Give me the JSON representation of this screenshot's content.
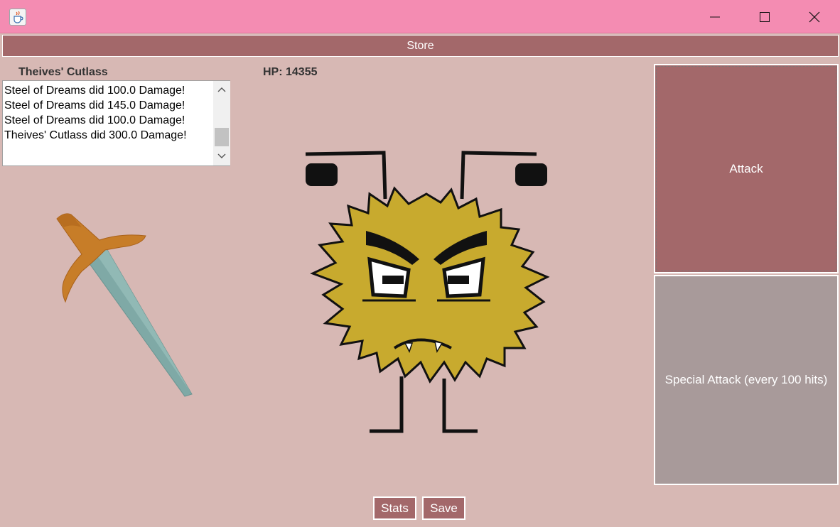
{
  "window": {
    "icon": "java-cup-icon",
    "controls": [
      "minimize-icon",
      "maximize-icon",
      "close-icon"
    ]
  },
  "store": {
    "label": "Store"
  },
  "weapon": {
    "name": "Theives' Cutlass",
    "image": "sword-icon"
  },
  "enemy": {
    "hp_text": "HP: 14355",
    "image": "fuzzy-yellow-monster"
  },
  "log": {
    "lines": [
      "Steel of Dreams did 100.0 Damage!",
      "Steel of Dreams did 145.0 Damage!",
      "Steel of Dreams did 100.0 Damage!",
      "Theives' Cutlass did 300.0 Damage!"
    ]
  },
  "actions": {
    "attack_label": "Attack",
    "special_label": "Special Attack (every 100 hits)"
  },
  "footer": {
    "stats_label": "Stats",
    "save_label": "Save"
  },
  "colors": {
    "titlebar": "#f48cb2",
    "background": "#d7b8b4",
    "button": "#a3686a",
    "special_button": "#a89a9a",
    "monster": "#c8aa2e"
  }
}
